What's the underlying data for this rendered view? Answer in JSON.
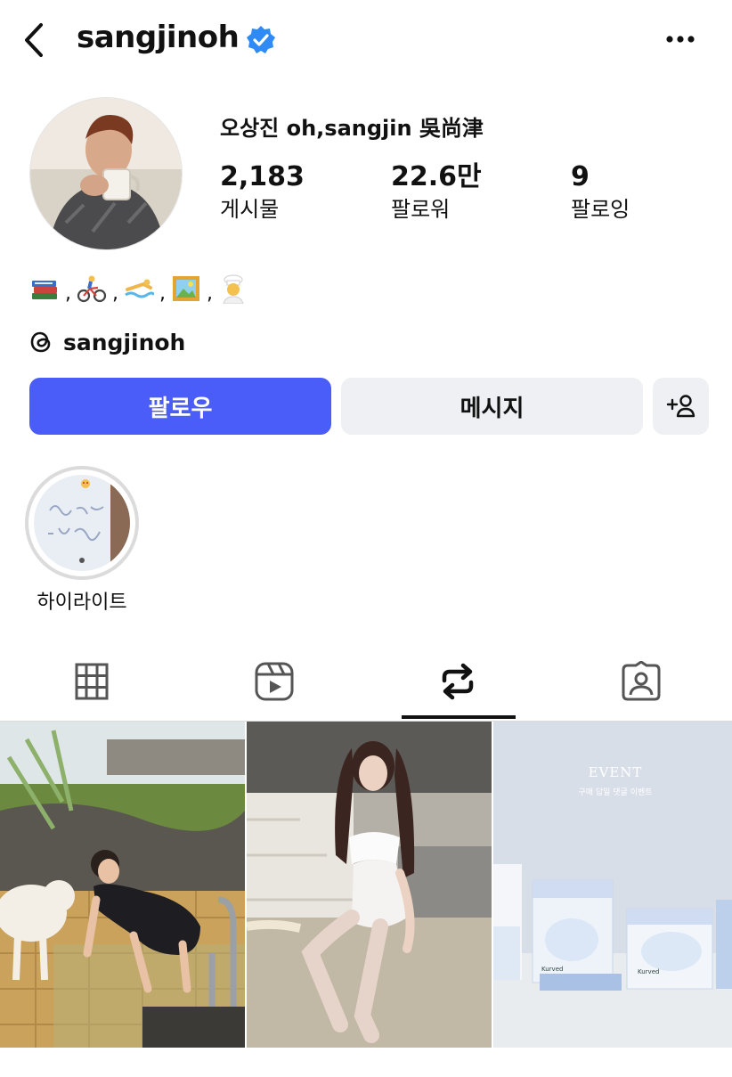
{
  "header": {
    "username": "sangjinoh",
    "icons": {
      "back": "chevron-left-icon",
      "verified": "verified-badge-icon",
      "more": "more-horizontal-icon"
    }
  },
  "profile": {
    "full_name": "오상진 oh,sangjin 吳尚津",
    "stats": [
      {
        "value": "2,183",
        "label": "게시물"
      },
      {
        "value": "22.6만",
        "label": "팔로워"
      },
      {
        "value": "9",
        "label": "팔로잉"
      }
    ],
    "bio_emojis": [
      "books-emoji",
      "cyclist-emoji",
      "swimmer-emoji",
      "framed-picture-emoji",
      "cook-emoji"
    ],
    "threads_handle": "sangjinoh"
  },
  "actions": {
    "follow_label": "팔로우",
    "message_label": "메시지",
    "add_user_icon": "add-person-icon"
  },
  "highlights": [
    {
      "label": "하이라이트"
    }
  ],
  "tabs": [
    {
      "icon": "grid-icon",
      "active": false
    },
    {
      "icon": "reels-icon",
      "active": false
    },
    {
      "icon": "reposts-icon",
      "active": true
    },
    {
      "icon": "tagged-icon",
      "active": false
    }
  ],
  "posts": [
    {
      "kind": "photo"
    },
    {
      "kind": "photo"
    },
    {
      "kind": "ad",
      "headline": "EVENT",
      "subline": "구매 답일 댓글 이벤트",
      "brand": "Kurved"
    }
  ],
  "colors": {
    "accent": "#4a5df9",
    "verified": "#2f8af5",
    "button_bg": "#eef0f3"
  }
}
